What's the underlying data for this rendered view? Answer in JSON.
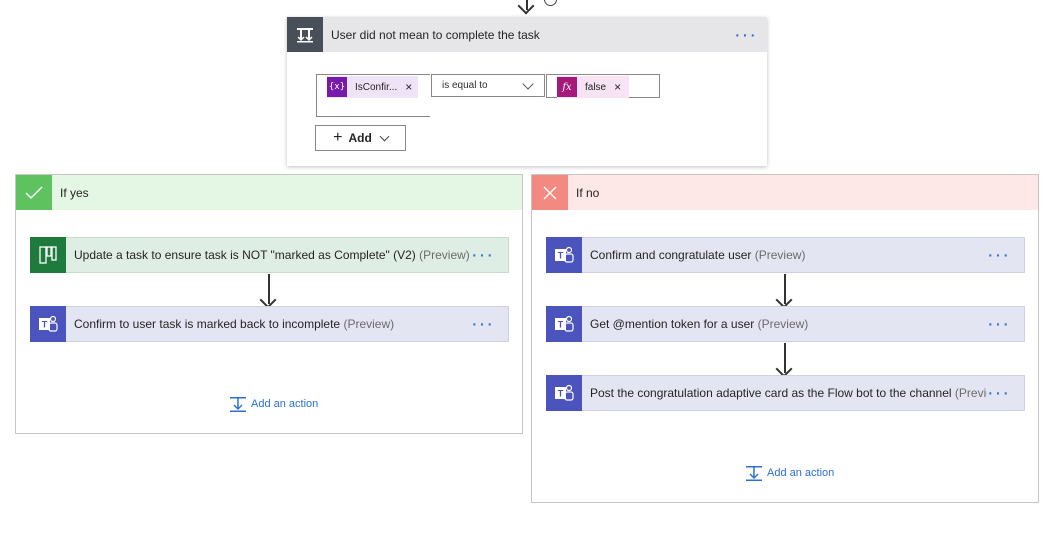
{
  "condition": {
    "title": "User did not mean to complete the task",
    "left_token": "IsConfir...",
    "left_token_icon": "{x}",
    "operator": "is equal to",
    "right_token": "false",
    "right_token_icon": "fx",
    "add_label": "Add"
  },
  "branches": {
    "yes": {
      "label": "If yes",
      "actions": [
        {
          "title": "Update a task to ensure task is NOT \"marked as Complete\" (V2)",
          "preview": "(Preview)",
          "icon": "planner-icon"
        },
        {
          "title": "Confirm to user task is marked back to incomplete",
          "preview": "(Preview)",
          "icon": "teams-icon"
        }
      ],
      "add_action": "Add an action"
    },
    "no": {
      "label": "If no",
      "actions": [
        {
          "title": "Confirm and congratulate user",
          "preview": "(Preview)",
          "icon": "teams-icon"
        },
        {
          "title": "Get @mention token for a user",
          "preview": "(Preview)",
          "icon": "teams-icon"
        },
        {
          "title": "Post the congratulation adaptive card as the Flow bot to the channel",
          "preview": "(Preview)",
          "icon": "teams-icon"
        }
      ],
      "add_action": "Add an action"
    }
  },
  "colors": {
    "condition_header": "#e6e6e9",
    "condition_icon_bg": "#484f58",
    "yes_header": "#e4f6e4",
    "yes_badge": "#5ec35e",
    "no_header": "#fde7e7",
    "no_badge": "#f28a82",
    "teams": "#4b53bc",
    "planner": "#1f7a3e",
    "link": "#2b6fd6"
  }
}
